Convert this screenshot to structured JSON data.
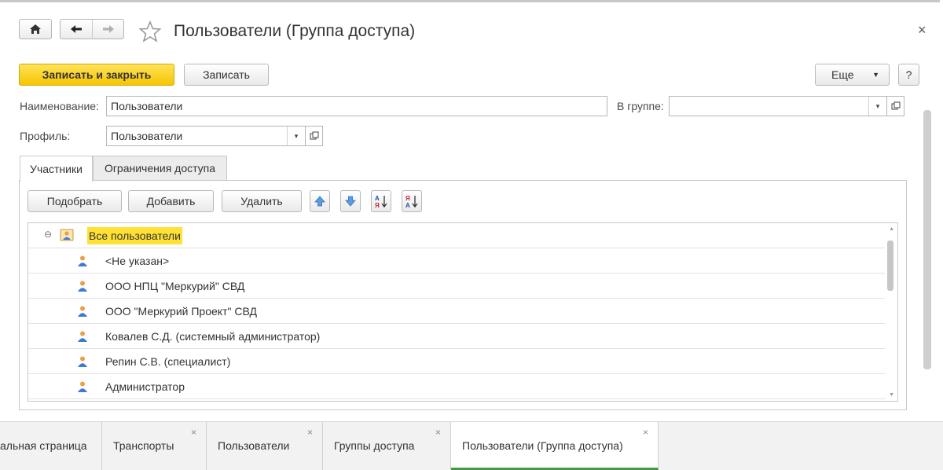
{
  "window": {
    "title": "Пользователи (Группа доступа)",
    "close_glyph": "×"
  },
  "toolbar": {
    "save_close_label": "Записать и закрыть",
    "save_label": "Записать",
    "more_label": "Еще",
    "more_arrow": "▼",
    "help_label": "?"
  },
  "form": {
    "name_label": "Наименование:",
    "name_value": "Пользователи",
    "group_label": "В группе:",
    "group_value": "",
    "profile_label": "Профиль:",
    "profile_value": "Пользователи",
    "dropdown_arrow": "▾"
  },
  "tabs": [
    {
      "label": "Участники",
      "active": true
    },
    {
      "label": "Ограничения доступа",
      "active": false
    }
  ],
  "members_toolbar": {
    "pick_label": "Подобрать",
    "add_label": "Добавить",
    "delete_label": "Удалить"
  },
  "list": {
    "collapse_glyph": "⊖",
    "root_label": "Все пользователи",
    "items": [
      "<Не указан>",
      "ООО НПЦ \"Меркурий\" СВД",
      "ООО \"Меркурий Проект\" СВД",
      "Ковалев С.Д. (системный администратор)",
      "Репин С.В. (специалист)",
      "Администратор"
    ],
    "scroll_up": "▲",
    "scroll_down": "▼"
  },
  "bottom_tabs": [
    {
      "label": "альная страница",
      "active": false
    },
    {
      "label": "Транспорты",
      "active": false
    },
    {
      "label": "Пользователи",
      "active": false
    },
    {
      "label": "Группы доступа",
      "active": false
    },
    {
      "label": "Пользователи (Группа доступа)",
      "active": true
    }
  ],
  "bottom_close_glyph": "×",
  "colors": {
    "primary_button": "#f5c500",
    "highlight": "#ffe135",
    "active_tab_underline": "#3f9a41",
    "user_icon_body": "#3a7bd5",
    "user_icon_head": "#e8a04a"
  }
}
